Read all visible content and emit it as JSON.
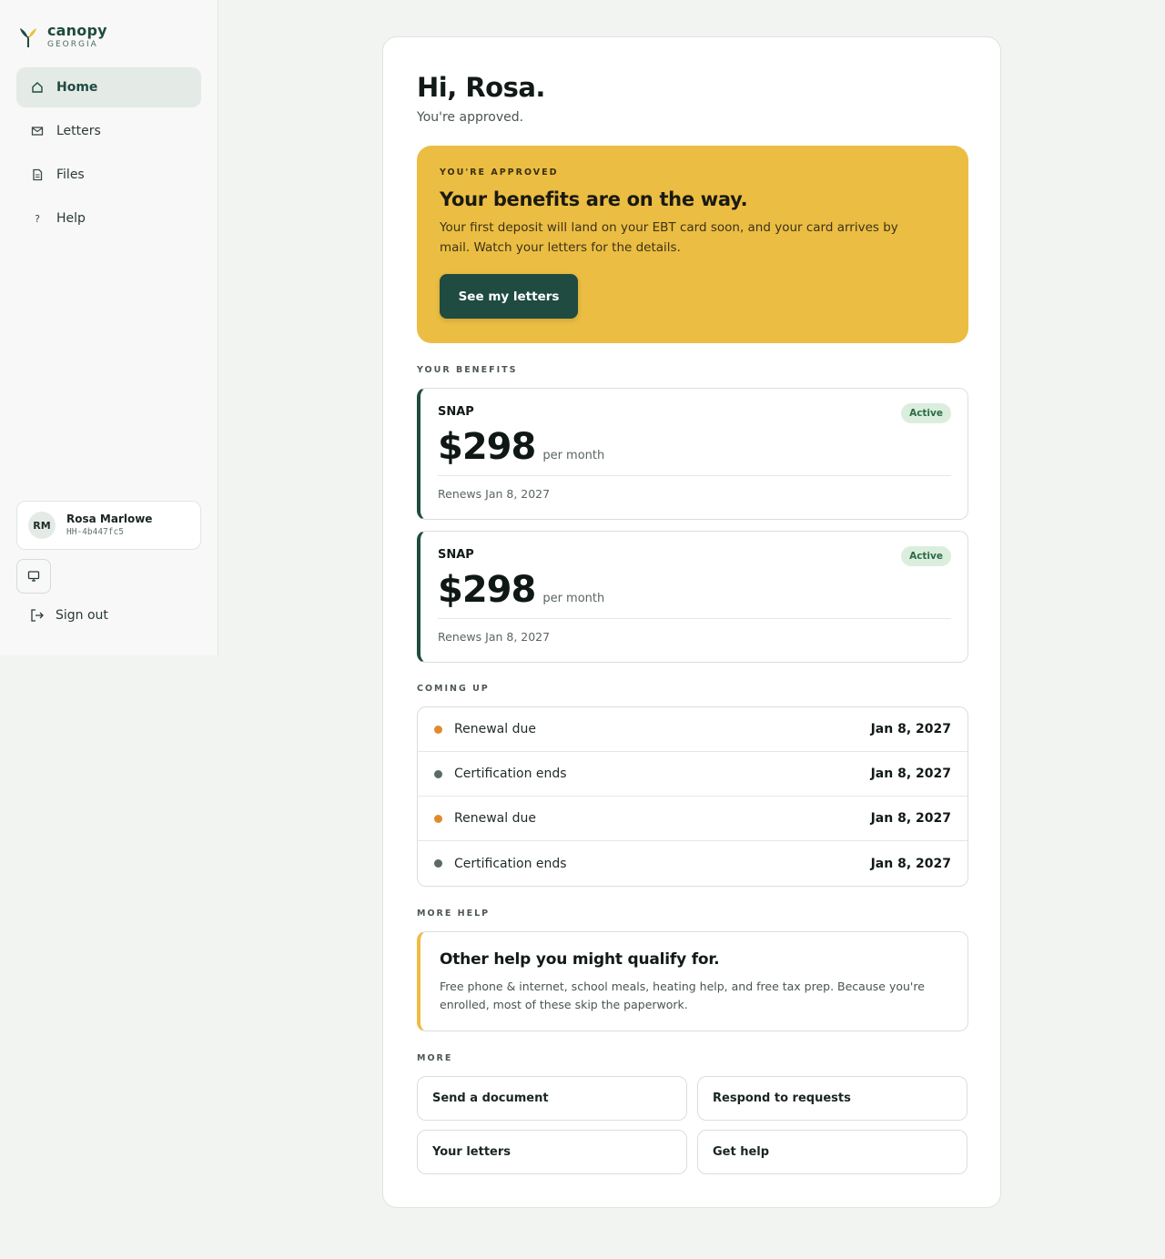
{
  "brand": {
    "name": "canopy",
    "region": "GEORGIA"
  },
  "nav": {
    "items": [
      {
        "label": "Home",
        "icon": "home-icon",
        "active": true
      },
      {
        "label": "Letters",
        "icon": "mail-icon",
        "active": false
      },
      {
        "label": "Files",
        "icon": "file-icon",
        "active": false
      },
      {
        "label": "Help",
        "icon": "help-icon",
        "active": false
      }
    ]
  },
  "user": {
    "initials": "RM",
    "name": "Rosa Marlowe",
    "id": "HH-4b447fc5"
  },
  "sidebar_footer": {
    "signout_label": "Sign out"
  },
  "greeting": {
    "title": "Hi, Rosa.",
    "subtitle": "You're approved."
  },
  "approved_banner": {
    "eyebrow": "YOU'RE APPROVED",
    "heading": "Your benefits are on the way.",
    "body": "Your first deposit will land on your EBT card soon, and your card arrives by mail. Watch your letters for the details.",
    "button_label": "See my letters"
  },
  "benefits": {
    "section_label": "YOUR BENEFITS",
    "items": [
      {
        "program": "SNAP",
        "status": "Active",
        "amount": "$298",
        "period": "per month",
        "renews": "Renews Jan 8, 2027"
      },
      {
        "program": "SNAP",
        "status": "Active",
        "amount": "$298",
        "period": "per month",
        "renews": "Renews Jan 8, 2027"
      }
    ]
  },
  "coming_up": {
    "section_label": "COMING UP",
    "items": [
      {
        "label": "Renewal due",
        "date": "Jan 8, 2027",
        "dot_color": "#e08a2e"
      },
      {
        "label": "Certification ends",
        "date": "Jan 8, 2027",
        "dot_color": "#5b6a63"
      },
      {
        "label": "Renewal due",
        "date": "Jan 8, 2027",
        "dot_color": "#e08a2e"
      },
      {
        "label": "Certification ends",
        "date": "Jan 8, 2027",
        "dot_color": "#5b6a63"
      }
    ]
  },
  "more_help": {
    "section_label": "MORE HELP",
    "heading": "Other help you might qualify for.",
    "body": "Free phone & internet, school meals, heating help, and free tax prep. Because you're enrolled, most of these skip the paperwork."
  },
  "more": {
    "section_label": "MORE",
    "links": [
      "Send a document",
      "Respond to requests",
      "Your letters",
      "Get help"
    ]
  },
  "colors": {
    "accent": "#1f4b40",
    "banner": "#ebbd43",
    "active_badge": "#dbeede"
  }
}
